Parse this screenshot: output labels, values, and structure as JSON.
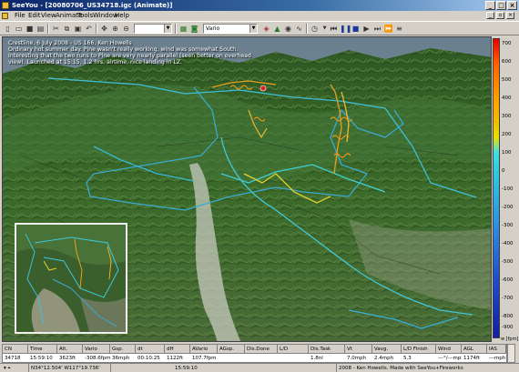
{
  "window": {
    "title": "SeeYou - [20080706_US34718.igc (Animate)]"
  },
  "menu": [
    "File",
    "Edit",
    "View",
    "Animate",
    "Tools",
    "Window",
    "Help"
  ],
  "toolbar": {
    "zoom_value": "",
    "vario_value": "Vario"
  },
  "map": {
    "description_lines": [
      "Crestline, 6 July 2008 - US 166, Ken Howells",
      "Ordinary hot summer day.  Pine wasn't really working, wind was somewhat South.",
      "Interesting that the two runs to Pine are very nearly parallel (seen better on overhead",
      "view).  Launched at 15:15, 1.2 hrs, airtime, nice landing in LZ."
    ]
  },
  "legend": {
    "ticks": [
      "700",
      "600",
      "500",
      "400",
      "300",
      "200",
      "100",
      "0",
      "-100",
      "-200",
      "-300",
      "-400",
      "-500",
      "-600",
      "-700",
      "-800",
      "-900"
    ],
    "unit": "w [fpm]"
  },
  "grid": {
    "columns": [
      "CN",
      "Time",
      "Alt.",
      "Vario",
      "Gsp.",
      "dt",
      "dH",
      "AVario",
      "AGsp.",
      "Dis.Done",
      "L/D",
      "Dis.Task",
      "Vt",
      "Vavg.",
      "L/D Finish",
      "Wind",
      "AGL",
      "IAS"
    ],
    "row": [
      "34718",
      "15:59:10",
      "3623ft",
      "-308.6fpm",
      "36mph",
      "00:10:25",
      "1122ft",
      "107.7fpm",
      "",
      "",
      "",
      "1.8nl",
      "7.0mph",
      "2.4mph",
      "5.3",
      "---°/---mph",
      "1174ft",
      "---mph"
    ]
  },
  "status": {
    "coords": "N34°12.504' W117°19.736'",
    "time": "15:59:10",
    "credit": "2008 - Ken Howells. Made with SeeYou+Fireworks"
  }
}
